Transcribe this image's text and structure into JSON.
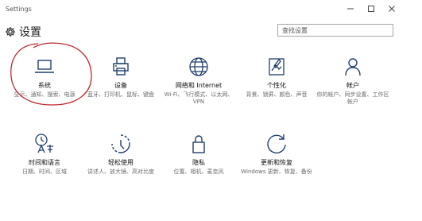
{
  "window": {
    "title": "Settings"
  },
  "header": {
    "title": "设置",
    "search_placeholder": "查找设置"
  },
  "tiles": [
    {
      "label": "系统",
      "desc": "显示、通知、搜索、电源",
      "icon": "laptop-icon"
    },
    {
      "label": "设备",
      "desc": "蓝牙、打印机、鼠标、键盘",
      "icon": "printer-icon"
    },
    {
      "label": "网络和 Internet",
      "desc": "Wi-Fi、飞行模式、以太网、VPN",
      "icon": "globe-icon"
    },
    {
      "label": "个性化",
      "desc": "背景、锁屏、颜色、声音",
      "icon": "paint-icon"
    },
    {
      "label": "帐户",
      "desc": "你的帐户、同步设置、工作区帐户",
      "icon": "person-icon"
    },
    {
      "label": "时间和语言",
      "desc": "日期、时间、区域",
      "icon": "time-language-icon"
    },
    {
      "label": "轻松使用",
      "desc": "讲述人、放大镜、高对比度",
      "icon": "ease-of-access-icon"
    },
    {
      "label": "隐私",
      "desc": "位置、相机、麦克风",
      "icon": "lock-icon"
    },
    {
      "label": "更新和恢复",
      "desc": "Windows 更新、恢复、备份",
      "icon": "refresh-icon"
    }
  ],
  "colors": {
    "accent": "#1f3f6b",
    "annotation": "#c0282d"
  }
}
